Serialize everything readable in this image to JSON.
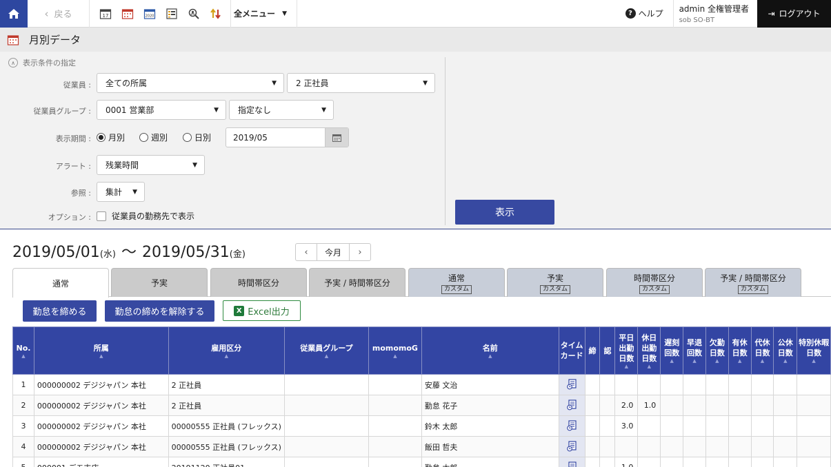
{
  "topbar": {
    "back_label": "戻る",
    "menu_label": "全メニュー",
    "help_label": "ヘルプ",
    "user_name": "admin 全権管理者",
    "user_sub": "sob SO-BT",
    "logout_label": "ログアウト",
    "tool_icons": [
      "calendar-17-icon",
      "calendar-grid-icon",
      "calendar-2020-icon",
      "list-chart-icon",
      "person-search-icon",
      "sort-arrows-icon"
    ]
  },
  "page": {
    "title": "月別データ"
  },
  "filter": {
    "section_title": "表示条件の指定",
    "employee_label": "従業員 :",
    "employee_dept": "全ての所属",
    "employee_type": "2 正社員",
    "group_label": "従業員グループ :",
    "group_value": "0001 営業部",
    "group_sub": "指定なし",
    "period_label": "表示期間 :",
    "period_monthly": "月別",
    "period_weekly": "週別",
    "period_daily": "日別",
    "period_value": "2019/05",
    "alert_label": "アラート :",
    "alert_value": "残業時間",
    "ref_label": "参照 :",
    "ref_value": "集計",
    "option_label": "オプション :",
    "option_text": "従業員の勤務先で表示",
    "show_button": "表示"
  },
  "range": {
    "start": "2019/05/01",
    "start_dow": "(水)",
    "tilde": "〜",
    "end": "2019/05/31",
    "end_dow": "(金)",
    "this_month": "今月"
  },
  "tabs": [
    {
      "label": "通常",
      "badge": ""
    },
    {
      "label": "予実",
      "badge": ""
    },
    {
      "label": "時間帯区分",
      "badge": ""
    },
    {
      "label": "予実 / 時間帯区分",
      "badge": ""
    },
    {
      "label": "通常",
      "badge": "カスタム"
    },
    {
      "label": "予実",
      "badge": "カスタム"
    },
    {
      "label": "時間帯区分",
      "badge": "カスタム"
    },
    {
      "label": "予実 / 時間帯区分",
      "badge": "カスタム"
    }
  ],
  "actions": {
    "close_btn": "勤怠を締める",
    "unclose_btn": "勤怠の締めを解除する",
    "excel_btn": "Excel出力"
  },
  "table": {
    "headers": {
      "no": "No.",
      "dept": "所属",
      "emp_type": "雇用区分",
      "group": "従業員グループ",
      "momo": "momomoG",
      "name": "名前",
      "timecard_1": "タイム",
      "timecard_2": "カード",
      "close": "締",
      "approve": "認",
      "weekday_1": "平日",
      "weekday_2": "出勤",
      "weekday_3": "日数",
      "holiday_1": "休日",
      "holiday_2": "出勤",
      "holiday_3": "日数",
      "late_1": "遅刻",
      "late_2": "回数",
      "early_1": "早退",
      "early_2": "回数",
      "absent_1": "欠勤",
      "absent_2": "日数",
      "paid_1": "有休",
      "paid_2": "日数",
      "sub_1": "代休",
      "sub_2": "日数",
      "public_1": "公休",
      "public_2": "日数",
      "special_1": "特別休暇",
      "special_2": "日数"
    },
    "rows": [
      {
        "no": "1",
        "dept": "000000002 デジジャパン 本社",
        "emp_type": "2 正社員",
        "name": "安藤 文治",
        "weekday": "",
        "holiday": ""
      },
      {
        "no": "2",
        "dept": "000000002 デジジャパン 本社",
        "emp_type": "2 正社員",
        "name": "勤怠 花子",
        "weekday": "2.0",
        "holiday": "1.0"
      },
      {
        "no": "3",
        "dept": "000000002 デジジャパン 本社",
        "emp_type": "00000555 正社員 (フレックス)",
        "name": "鈴木 太郎",
        "weekday": "3.0",
        "holiday": ""
      },
      {
        "no": "4",
        "dept": "000000002 デジジャパン 本社",
        "emp_type": "00000555 正社員 (フレックス)",
        "name": "飯田 哲夫",
        "weekday": "",
        "holiday": ""
      },
      {
        "no": "5",
        "dept": "000001 デモ支店",
        "emp_type": "20191120 正社員01",
        "name": "勤怠 太郎",
        "weekday": "1.0",
        "holiday": ""
      }
    ]
  },
  "colors": {
    "primary": "#3749a1",
    "header": "#3345a3",
    "topbar_home": "#2e47a0"
  }
}
